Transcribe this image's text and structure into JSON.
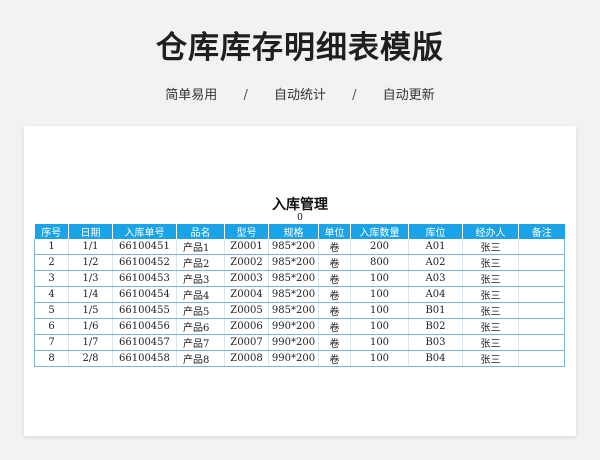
{
  "header": {
    "title": "仓库库存明细表模版",
    "tags": [
      "简单易用",
      "自动统计",
      "自动更新"
    ],
    "separator": "/"
  },
  "sheet": {
    "title": "入库管理",
    "subtitle": "0",
    "columns": [
      "序号",
      "日期",
      "入库单号",
      "品名",
      "型号",
      "规格",
      "单位",
      "入库数量",
      "库位",
      "经办人",
      "备注"
    ],
    "rows": [
      [
        "1",
        "1/1",
        "66100451",
        "产品1",
        "Z0001",
        "985*200",
        "卷",
        "200",
        "A01",
        "张三",
        ""
      ],
      [
        "2",
        "1/2",
        "66100452",
        "产品2",
        "Z0002",
        "985*200",
        "卷",
        "800",
        "A02",
        "张三",
        ""
      ],
      [
        "3",
        "1/3",
        "66100453",
        "产品3",
        "Z0003",
        "985*200",
        "卷",
        "100",
        "A03",
        "张三",
        ""
      ],
      [
        "4",
        "1/4",
        "66100454",
        "产品4",
        "Z0004",
        "985*200",
        "卷",
        "100",
        "A04",
        "张三",
        ""
      ],
      [
        "5",
        "1/5",
        "66100455",
        "产品5",
        "Z0005",
        "985*200",
        "卷",
        "100",
        "B01",
        "张三",
        ""
      ],
      [
        "6",
        "1/6",
        "66100456",
        "产品6",
        "Z0006",
        "990*200",
        "卷",
        "100",
        "B02",
        "张三",
        ""
      ],
      [
        "7",
        "1/7",
        "66100457",
        "产品7",
        "Z0007",
        "990*200",
        "卷",
        "100",
        "B03",
        "张三",
        ""
      ],
      [
        "8",
        "2/8",
        "66100458",
        "产品8",
        "Z0008",
        "990*200",
        "卷",
        "100",
        "B04",
        "张三",
        ""
      ]
    ]
  },
  "colors": {
    "header_bg": "#1aa3e6",
    "border": "#7fb3d8"
  }
}
